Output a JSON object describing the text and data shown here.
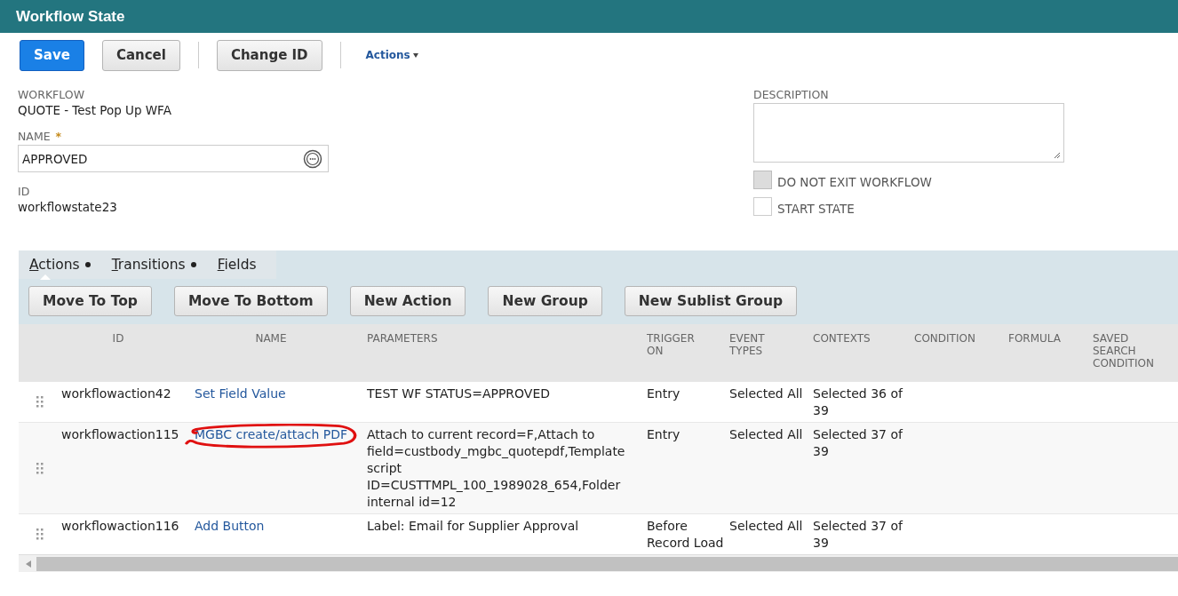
{
  "window": {
    "title": "Workflow State"
  },
  "toolbar": {
    "buttons": [
      {
        "label": "Save",
        "kind": "primary"
      },
      {
        "label": "Cancel",
        "kind": "secondary"
      },
      {
        "label": "Change ID",
        "kind": "secondary"
      }
    ],
    "menu": "Actions"
  },
  "fields": {
    "workflow": {
      "label": "WORKFLOW",
      "value": "QUOTE - Test Pop Up WFA"
    },
    "name": {
      "label": "NAME",
      "required": true,
      "required_mark": "*",
      "value": "APPROVED"
    },
    "id": {
      "label": "ID",
      "value": "workflowstate23"
    },
    "description": {
      "label": "DESCRIPTION"
    },
    "checkboxes": [
      {
        "label": "DO NOT EXIT WORKFLOW",
        "checked": false,
        "disabled": true
      },
      {
        "label": "START STATE",
        "checked": false,
        "disabled": false
      }
    ]
  },
  "subtabs": [
    {
      "label": "Actions",
      "selected": true,
      "has_items": true
    },
    {
      "label": "Transitions",
      "selected": false,
      "has_items": true
    },
    {
      "label": "Fields",
      "selected": false,
      "has_items": false
    }
  ],
  "sublist_buttons": [
    "Move To Top",
    "Move To Bottom",
    "New Action",
    "New Group",
    "New Sublist Group"
  ],
  "table": {
    "columns": [
      "ID",
      "NAME",
      "PARAMETERS",
      "TRIGGER ON",
      "EVENT TYPES",
      "CONTEXTS",
      "CONDITION",
      "FORMULA",
      "SAVED SEARCH CONDITION"
    ],
    "rows": [
      {
        "id": "workflowaction42",
        "name": "Set Field Value",
        "circled": false,
        "parameters": "TEST WF STATUS=APPROVED",
        "trigger_on": "Entry",
        "event_types": "Selected All",
        "contexts": "Selected 36 of 39"
      },
      {
        "id": "workflowaction115",
        "name": "MGBC create/attach PDF",
        "circled": true,
        "parameters": "Attach to current record=F,Attach to field=custbody_mgbc_quotepdf,Template script ID=CUSTTMPL_100_1989028_654,Folder internal id=12",
        "trigger_on": "Entry",
        "event_types": "Selected All",
        "contexts": "Selected 37 of 39"
      },
      {
        "id": "workflowaction116",
        "name": "Add Button",
        "circled": false,
        "parameters": "Label: Email for Supplier Approval",
        "trigger_on": "Before Record Load",
        "event_types": "Selected All",
        "contexts": "Selected 37 of 39"
      }
    ]
  }
}
